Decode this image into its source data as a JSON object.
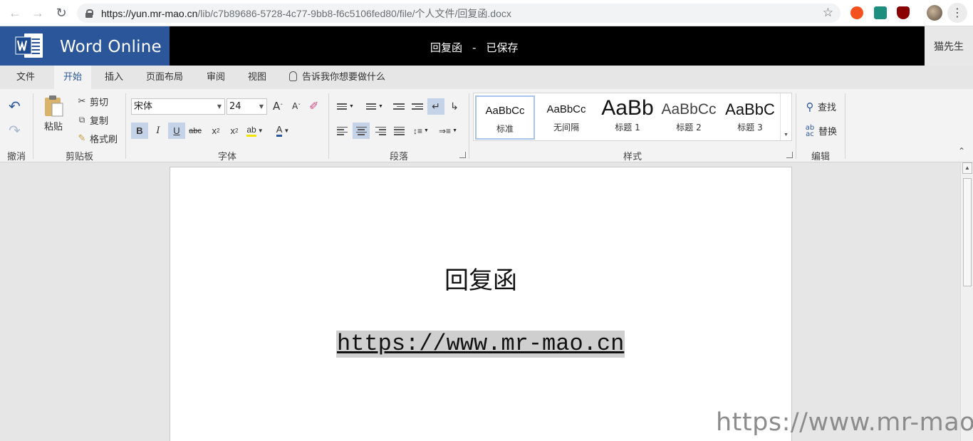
{
  "browser": {
    "url_host": "https://yun.mr-mao.cn",
    "url_path": "/lib/c7b89686-5728-4c77-9bb8-f6c5106fed80/file/个人文件/回复函.docx"
  },
  "header": {
    "app_name": "Word Online",
    "doc_name": "回复函",
    "separator": "-",
    "save_status": "已保存",
    "user_name": "猫先生"
  },
  "tabs": [
    {
      "label": "文件"
    },
    {
      "label": "开始",
      "active": true
    },
    {
      "label": "插入"
    },
    {
      "label": "页面布局"
    },
    {
      "label": "审阅"
    },
    {
      "label": "视图"
    }
  ],
  "tell_me": "告诉我你想要做什么",
  "ribbon": {
    "undo_group": {
      "label": "撤消"
    },
    "clipboard": {
      "label": "剪贴板",
      "paste": "粘贴",
      "cut": "剪切",
      "copy": "复制",
      "format_painter": "格式刷"
    },
    "font": {
      "label": "字体",
      "font_name": "宋体",
      "font_size": "24",
      "grow": "A",
      "shrink": "A",
      "bold": "B",
      "italic": "I",
      "underline": "U",
      "strike": "abc",
      "subscript": "x",
      "superscript": "x",
      "highlight": "ab",
      "font_color": "A"
    },
    "paragraph": {
      "label": "段落"
    },
    "styles": {
      "label": "样式",
      "items": [
        {
          "sample": "AaBbCc",
          "name": "标准"
        },
        {
          "sample": "AaBbCc",
          "name": "无间隔"
        },
        {
          "sample": "AaBb",
          "name": "标题 1"
        },
        {
          "sample": "AaBbCc",
          "name": "标题 2"
        },
        {
          "sample": "AaBbC",
          "name": "标题 3"
        }
      ]
    },
    "editing": {
      "label": "编辑",
      "find": "查找",
      "replace": "替换"
    }
  },
  "document": {
    "title": "回复函",
    "link": "https://www.mr-mao.cn"
  },
  "watermark": "https://www.mr-mao.cn",
  "colors": {
    "word_blue": "#2b579a",
    "header_black": "#000000",
    "selection_gray": "#cfcfcf"
  }
}
